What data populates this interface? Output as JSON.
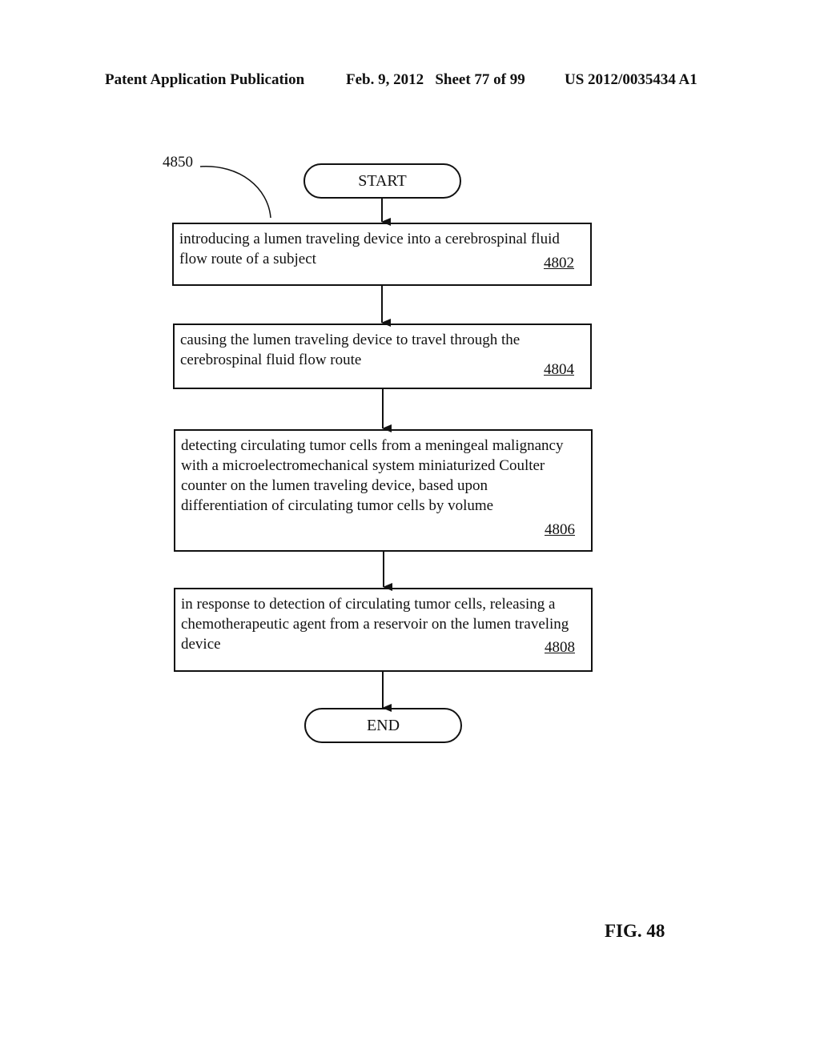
{
  "header": {
    "publication": "Patent Application Publication",
    "date_sheet": "Feb. 9, 2012   Sheet 77 of 99",
    "patent_number": "US 2012/0035434 A1"
  },
  "diagram": {
    "reference_label": "4850",
    "start_label": "START",
    "end_label": "END",
    "steps": [
      {
        "text": "introducing a lumen traveling device into a cerebrospinal fluid flow route of a subject",
        "number": "4802"
      },
      {
        "text": "causing the lumen traveling device to travel through the cerebrospinal fluid flow route",
        "number": "4804"
      },
      {
        "text": "detecting circulating tumor cells from a meningeal malignancy with a microelectromechanical system miniaturized Coulter counter on the lumen traveling device, based upon differentiation of circulating tumor cells by volume",
        "number": "4806"
      },
      {
        "text": "in response to detection of circulating tumor cells, releasing a chemotherapeutic agent from a reservoir on the lumen traveling device",
        "number": "4808"
      }
    ],
    "figure_label": "FIG. 48"
  }
}
